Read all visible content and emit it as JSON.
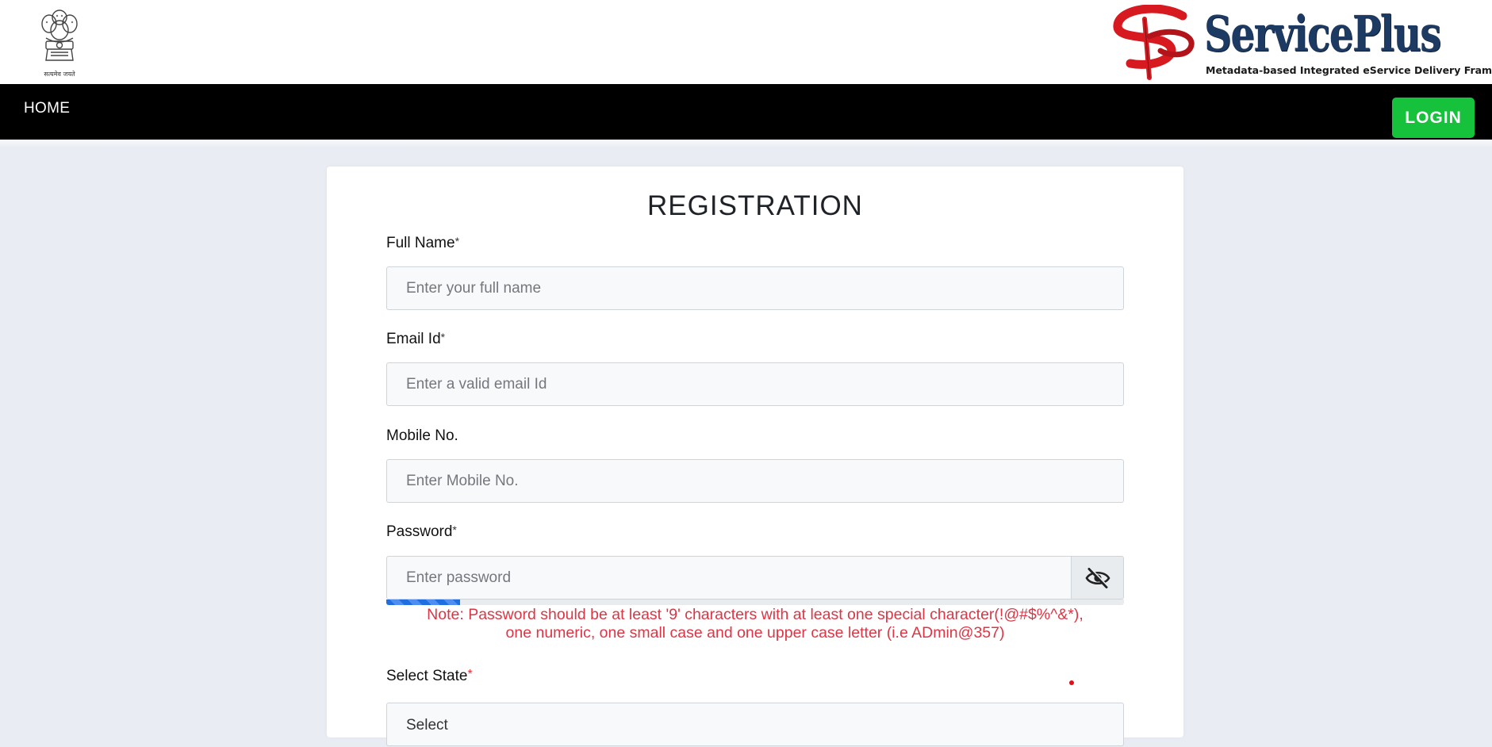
{
  "header": {
    "emblem_caption": "सत्यमेव जयते",
    "brand_name": "ServicePlus",
    "brand_tagline": "Metadata-based Integrated eService Delivery Framework"
  },
  "nav": {
    "home_label": "HOME",
    "login_label": "LOGIN"
  },
  "form": {
    "title": "REGISTRATION",
    "full_name": {
      "label": "Full Name",
      "required_mark": "*",
      "placeholder": "Enter your full name"
    },
    "email": {
      "label": "Email Id",
      "required_mark": "*",
      "placeholder": "Enter a valid email Id"
    },
    "mobile": {
      "label": "Mobile No.",
      "placeholder": "Enter Mobile No."
    },
    "password": {
      "label": "Password",
      "required_mark": "*",
      "placeholder": "Enter password",
      "toggle_icon": "eye-slash-icon",
      "strength_percent": 10,
      "note_line1": "Note: Password should be at least '9' characters with at least one special character(!@#$%^&*),",
      "note_line2": "one numeric, one small case and one upper case letter (i.e ADmin@357)"
    },
    "state": {
      "label": "Select State",
      "required_mark": "*",
      "selected": "Select"
    }
  },
  "colors": {
    "login_button": "#16c23b",
    "note_text": "#dc3545",
    "strength_bar": "#1f6fe0",
    "brand_blue": "#1d3a63",
    "brand_red": "#d71920"
  }
}
